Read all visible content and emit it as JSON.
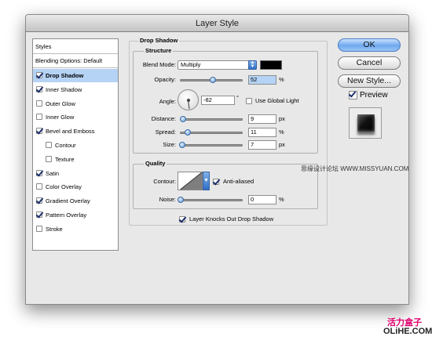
{
  "window": {
    "title": "Layer Style"
  },
  "sidebar": {
    "styles_label": "Styles",
    "blending_label": "Blending Options: Default",
    "items": [
      {
        "label": "Drop Shadow",
        "checked": true,
        "selected": true,
        "indent": false
      },
      {
        "label": "Inner Shadow",
        "checked": true,
        "selected": false,
        "indent": false
      },
      {
        "label": "Outer Glow",
        "checked": false,
        "selected": false,
        "indent": false
      },
      {
        "label": "Inner Glow",
        "checked": false,
        "selected": false,
        "indent": false
      },
      {
        "label": "Bevel and Emboss",
        "checked": true,
        "selected": false,
        "indent": false
      },
      {
        "label": "Contour",
        "checked": false,
        "selected": false,
        "indent": true
      },
      {
        "label": "Texture",
        "checked": false,
        "selected": false,
        "indent": true
      },
      {
        "label": "Satin",
        "checked": true,
        "selected": false,
        "indent": false
      },
      {
        "label": "Color Overlay",
        "checked": false,
        "selected": false,
        "indent": false
      },
      {
        "label": "Gradient Overlay",
        "checked": true,
        "selected": false,
        "indent": false
      },
      {
        "label": "Pattern Overlay",
        "checked": true,
        "selected": false,
        "indent": false
      },
      {
        "label": "Stroke",
        "checked": false,
        "selected": false,
        "indent": false
      }
    ]
  },
  "drop_shadow": {
    "section_title": "Drop Shadow",
    "structure": {
      "title": "Structure",
      "blend_mode_label": "Blend Mode:",
      "blend_mode_value": "Multiply",
      "shadow_color": "#000000",
      "opacity_label": "Opacity:",
      "opacity_value": "52",
      "opacity_unit": "%",
      "opacity_level": 0.52,
      "angle_label": "Angle:",
      "angle_value": "-82",
      "angle_unit": "°",
      "angle_degrees": -82,
      "use_global_light_label": "Use Global Light",
      "use_global_light_checked": false,
      "distance_label": "Distance:",
      "distance_value": "9",
      "distance_unit": "px",
      "distance_level": 0.04,
      "spread_label": "Spread:",
      "spread_value": "11",
      "spread_unit": "%",
      "spread_level": 0.11,
      "size_label": "Size:",
      "size_value": "7",
      "size_unit": "px",
      "size_level": 0.03
    },
    "quality": {
      "title": "Quality",
      "contour_label": "Contour:",
      "anti_aliased_label": "Anti-aliased",
      "anti_aliased_checked": true,
      "noise_label": "Noise:",
      "noise_value": "0",
      "noise_unit": "%",
      "noise_level": 0
    },
    "knockout_label": "Layer Knocks Out Drop Shadow",
    "knockout_checked": true
  },
  "buttons": {
    "ok": "OK",
    "cancel": "Cancel",
    "new_style": "New Style...",
    "preview_label": "Preview",
    "preview_checked": true
  },
  "watermarks": {
    "top": "思缘设计论坛 WWW.MISSYUAN.COM",
    "bottom_cn": "活力盒子",
    "bottom_en": "OLiHE.COM"
  }
}
